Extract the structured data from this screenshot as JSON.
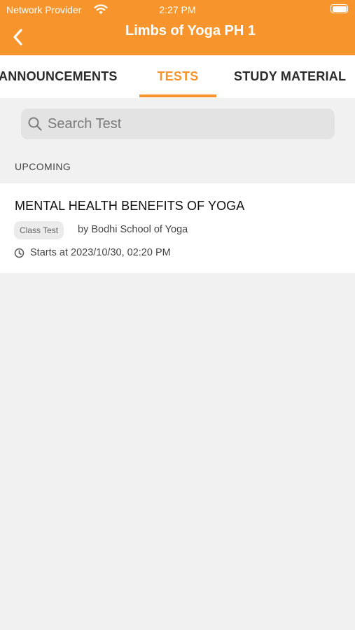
{
  "status_bar": {
    "carrier": "Network Provider",
    "time": "2:27 PM",
    "wifi_icon": "wifi-icon",
    "battery_icon": "battery-icon"
  },
  "header": {
    "title": "Limbs of Yoga PH 1",
    "back_icon": "chevron-left-icon",
    "background_color": "#f7952c"
  },
  "tabs": [
    {
      "label": "ANNOUNCEMENTS",
      "active": false
    },
    {
      "label": "TESTS",
      "active": true
    },
    {
      "label": "STUDY MATERIAL",
      "active": false
    }
  ],
  "search": {
    "placeholder": "Search Test",
    "value": "",
    "icon": "search-icon"
  },
  "section": {
    "label": "UPCOMING"
  },
  "tests": [
    {
      "title": "MENTAL HEALTH BENEFITS OF YOGA",
      "badge": "Class Test",
      "byline": "by Bodhi School of Yoga",
      "starts": "Starts at 2023/10/30, 02:20 PM",
      "icon": "clock-icon"
    }
  ],
  "colors": {
    "accent": "#f7952c",
    "background": "#f1f1f1",
    "search_background": "#e3e3e3"
  }
}
